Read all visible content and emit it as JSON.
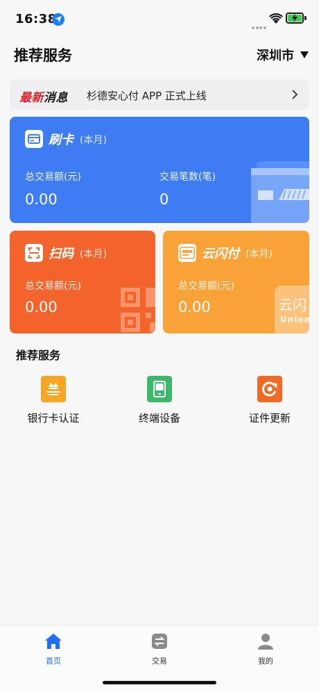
{
  "status_bar": {
    "time": "16:38"
  },
  "header": {
    "title": "推荐服务",
    "city": "深圳市"
  },
  "news": {
    "tag_red": "最新",
    "tag_dark": "消息",
    "text": "杉德安心付 APP 正式上线"
  },
  "cards": {
    "swipe": {
      "title": "刷卡",
      "period": "(本月)",
      "total_amount_label": "总交易额(元)",
      "total_amount_value": "0.00",
      "count_label": "交易笔数(笔)",
      "count_value": "0"
    },
    "scan": {
      "title": "扫码",
      "period": "(本月)",
      "total_amount_label": "总交易额(元)",
      "total_amount_value": "0.00"
    },
    "unionpay": {
      "title": "云闪付",
      "period": "(本月)",
      "total_amount_label": "总交易额(元)",
      "total_amount_value": "0.00",
      "watermark": "云闪",
      "watermark_sub": "Union"
    }
  },
  "services": {
    "title": "推荐服务",
    "items": [
      {
        "label": "银行卡认证",
        "icon": "bank-card-auth-icon",
        "color": "#f6a623"
      },
      {
        "label": "终端设备",
        "icon": "terminal-device-icon",
        "color": "#3cb86b"
      },
      {
        "label": "证件更新",
        "icon": "certificate-update-icon",
        "color": "#f06a25"
      }
    ]
  },
  "tabbar": {
    "items": [
      {
        "label": "首页",
        "icon": "home-icon",
        "active": true
      },
      {
        "label": "交易",
        "icon": "transaction-icon",
        "active": false
      },
      {
        "label": "我的",
        "icon": "profile-icon",
        "active": false
      }
    ],
    "active_color": "#1e6ff1",
    "inactive_color": "#333333"
  }
}
